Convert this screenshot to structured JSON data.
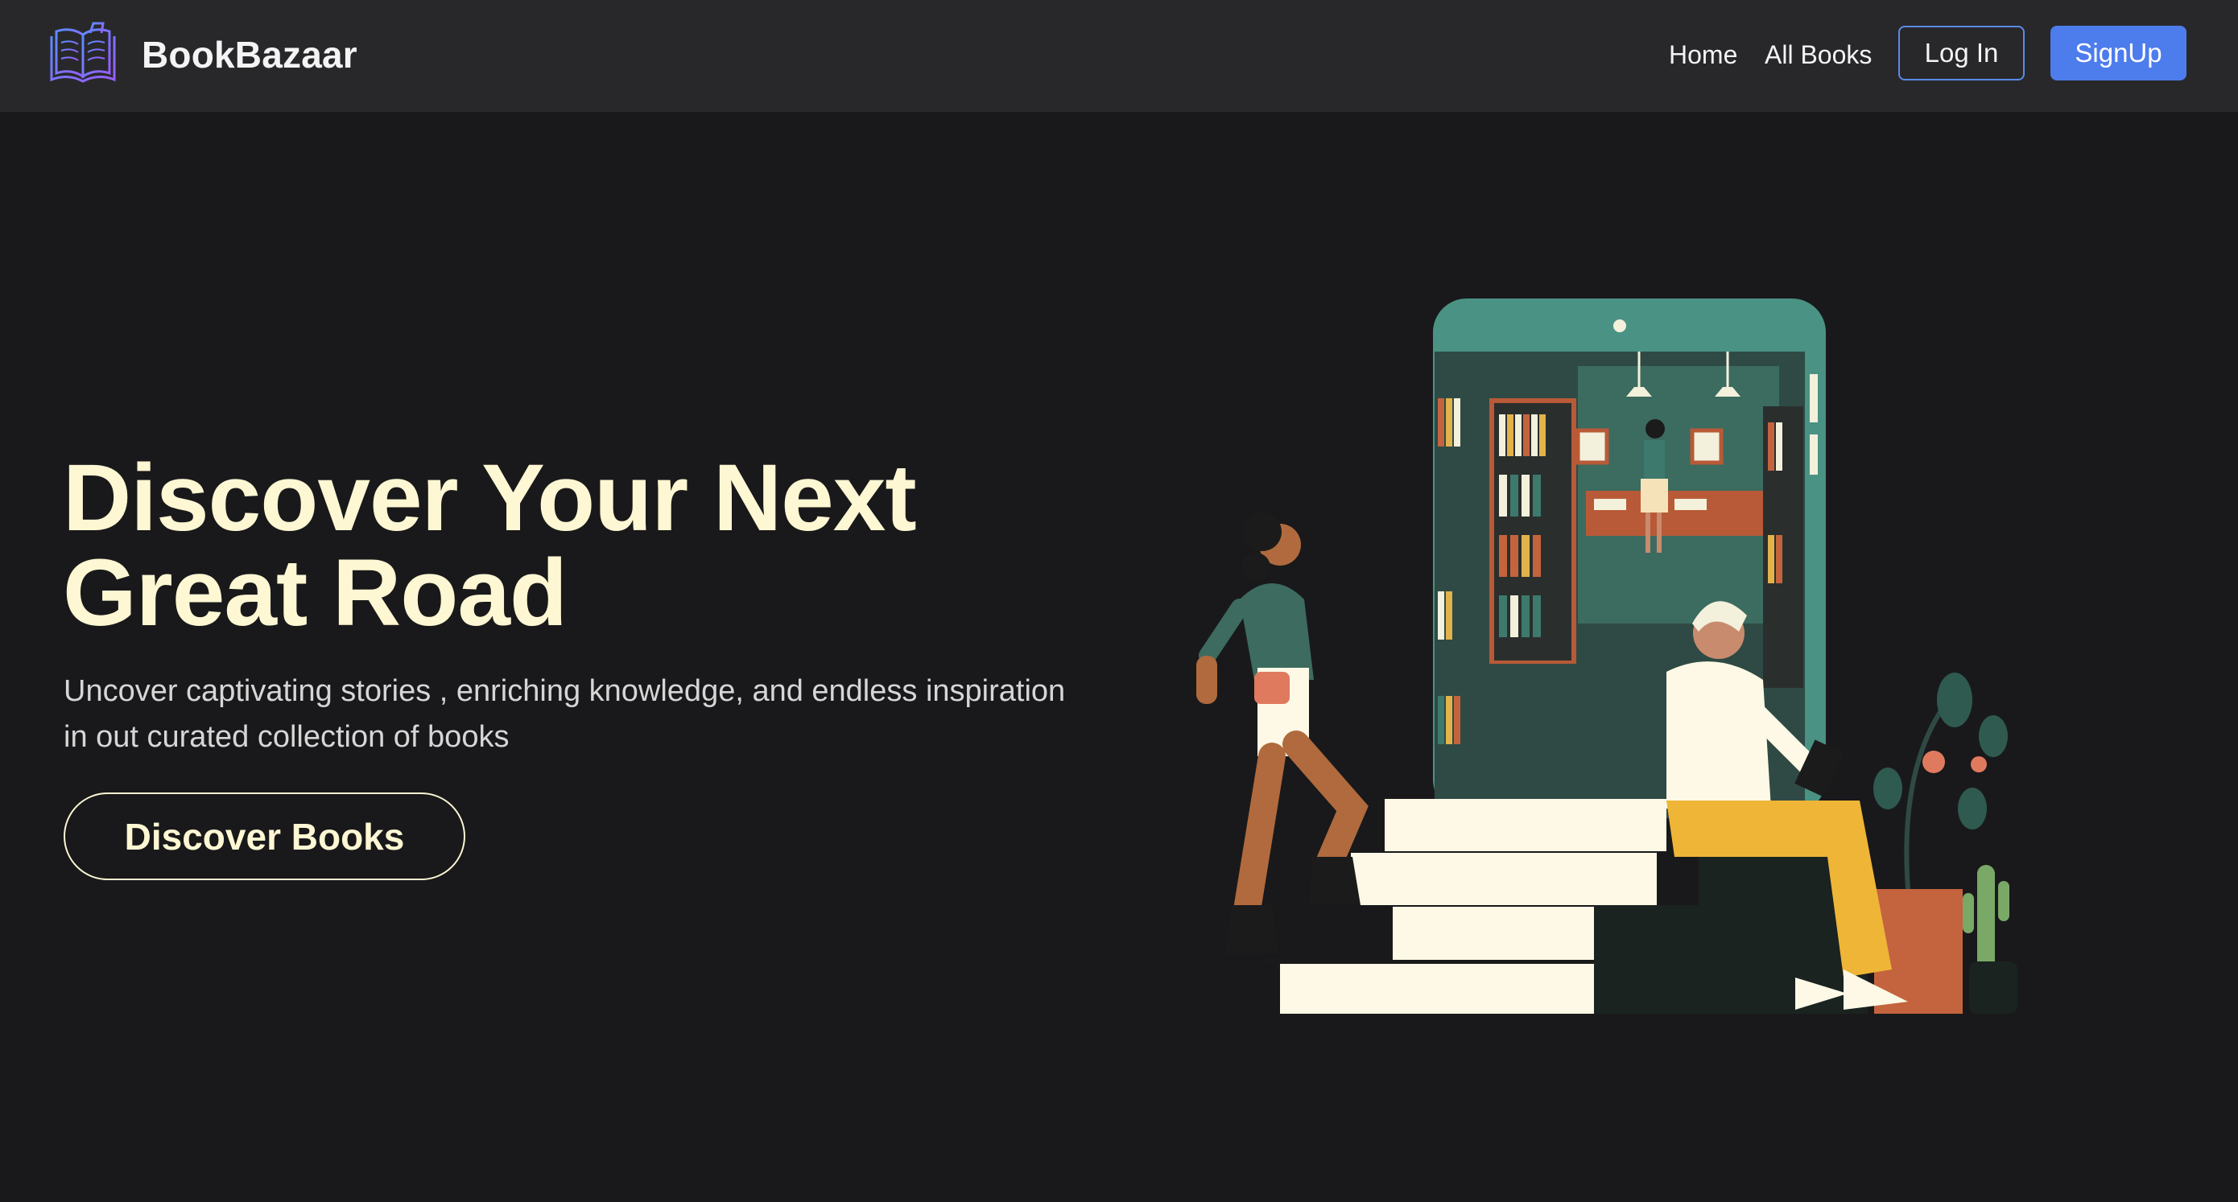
{
  "navbar": {
    "brand_name": "BookBazaar",
    "brand_icon": "open-book-icon",
    "links": {
      "home": "Home",
      "all_books": "All Books"
    },
    "login_label": "Log In",
    "signup_label": "SignUp"
  },
  "hero": {
    "title_line1": "Discover Your Next",
    "title_line2": "Great Road",
    "subtitle_line1": "Uncover captivating stories , enriching knowledge, and endless inspiration",
    "subtitle_line2": "in out curated collection of books",
    "cta_label": "Discover Books"
  },
  "colors": {
    "page_bg": "#19191b",
    "navbar_bg": "#28282b",
    "accent_blue": "#4d7cec",
    "hero_text": "#fdf7d3",
    "subtitle_text": "#d6d6d6"
  }
}
